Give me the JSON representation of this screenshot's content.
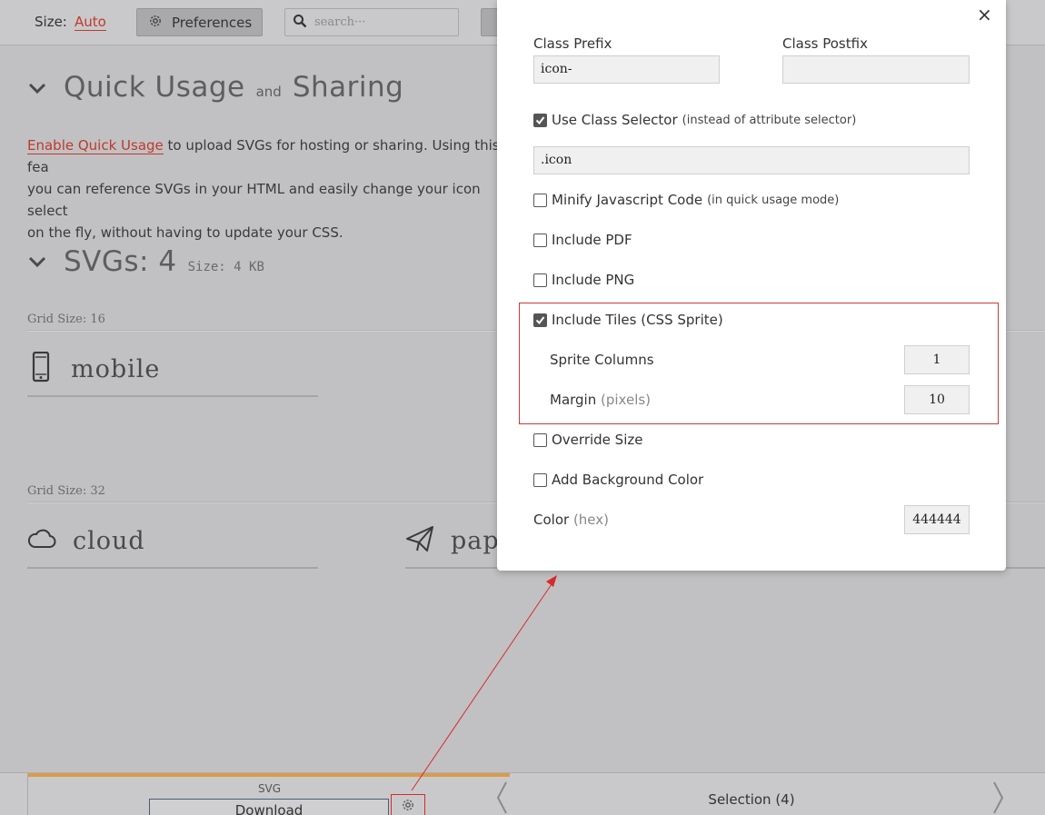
{
  "toolbar": {
    "size_label": "Size:",
    "size_value": "Auto",
    "preferences_label": "Preferences",
    "search_placeholder": "search···"
  },
  "quick_usage": {
    "title_part1": "Quick Usage",
    "title_and": "and",
    "title_part2": "Sharing",
    "link_text": "Enable Quick Usage",
    "line1_rest": " to upload SVGs for hosting or sharing. Using this fea",
    "line2": "you can reference SVGs in your HTML and easily change your icon select",
    "line3": "on the fly, without having to update your CSS."
  },
  "svgs": {
    "title": "SVGs: 4",
    "size": "Size: 4 KB",
    "groups": [
      {
        "label": "Grid Size: 16",
        "icons": [
          {
            "name": "mobile",
            "icon": "mobile-icon"
          }
        ]
      },
      {
        "label": "Grid Size: 32",
        "icons": [
          {
            "name": "cloud",
            "icon": "cloud-icon"
          },
          {
            "name": "pape",
            "icon": "paper-plane-icon"
          }
        ]
      }
    ]
  },
  "bottom": {
    "svg_label": "SVG",
    "download_label": "Download",
    "selection_label": "Selection (4)",
    "accent_color": "#d99c4a"
  },
  "modal": {
    "close": "×",
    "class_prefix_label": "Class Prefix",
    "class_prefix_value": "icon-",
    "class_postfix_label": "Class Postfix",
    "class_postfix_value": "",
    "use_class_selector_label": "Use Class Selector",
    "use_class_selector_note": "(instead of attribute selector)",
    "use_class_selector_checked": true,
    "selector_value": ".icon",
    "minify_label": "Minify Javascript Code",
    "minify_note": "(in quick usage mode)",
    "minify_checked": false,
    "include_pdf_label": "Include PDF",
    "include_pdf_checked": false,
    "include_png_label": "Include PNG",
    "include_png_checked": false,
    "include_tiles_label": "Include Tiles (CSS Sprite)",
    "include_tiles_checked": true,
    "sprite_columns_label": "Sprite Columns",
    "sprite_columns_value": "1",
    "margin_label": "Margin",
    "margin_unit": "(pixels)",
    "margin_value": "10",
    "override_size_label": "Override Size",
    "override_size_checked": false,
    "add_bg_label": "Add Background Color",
    "add_bg_checked": false,
    "color_label": "Color",
    "color_unit": "(hex)",
    "color_value": "444444"
  },
  "colors": {
    "link_red": "#c0392b",
    "highlight_red": "#c83a3a"
  }
}
